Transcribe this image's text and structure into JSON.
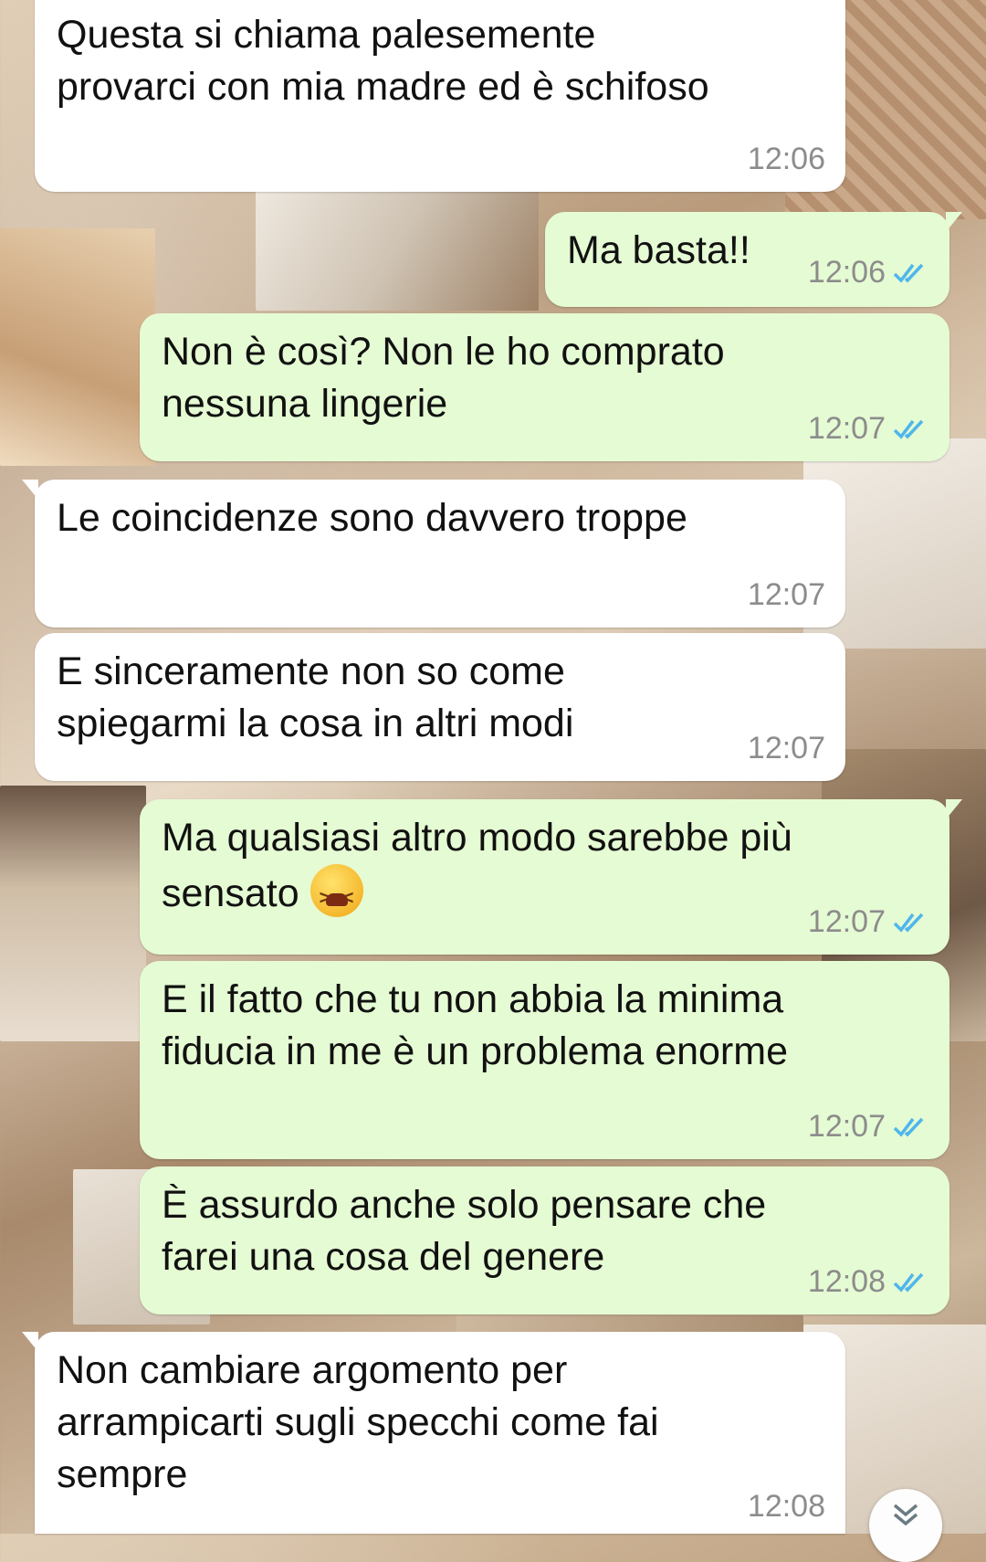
{
  "chat": {
    "messages": [
      {
        "direction": "incoming",
        "text": "Questa si chiama palesemente\nprovarci con mia madre ed è schifoso",
        "time": "12:06"
      },
      {
        "direction": "outgoing",
        "text": "Ma basta!!",
        "time": "12:06",
        "status": "read"
      },
      {
        "direction": "outgoing",
        "text": "Non è così? Non le ho comprato\nnessuna lingerie",
        "time": "12:07",
        "status": "read"
      },
      {
        "direction": "incoming",
        "text": "Le coincidenze sono davvero troppe",
        "time": "12:07"
      },
      {
        "direction": "incoming",
        "text": "E sinceramente non so come\nspiegarmi la cosa in altri modi",
        "time": "12:07"
      },
      {
        "direction": "outgoing",
        "text": "Ma qualsiasi altro modo sarebbe più\nsensato",
        "emoji": "tired-face",
        "time": "12:07",
        "status": "read"
      },
      {
        "direction": "outgoing",
        "text": "E il fatto che tu non abbia la minima\nfiducia in me è un problema enorme",
        "time": "12:07",
        "status": "read"
      },
      {
        "direction": "outgoing",
        "text": "È assurdo anche solo pensare che\nfarei una cosa del genere",
        "time": "12:08",
        "status": "read"
      },
      {
        "direction": "incoming",
        "text": "Non cambiare argomento per\narrampicarti sugli specchi come fai\nsempre",
        "time": "12:08"
      }
    ]
  },
  "colors": {
    "incoming_bubble": "#ffffff",
    "outgoing_bubble": "#e5fbd3",
    "read_ticks": "#4fb6ec",
    "timestamp": "#8c8c8c"
  },
  "icons": {
    "read_receipt": "double-check-icon",
    "scroll_down": "chevron-double-down-icon"
  }
}
